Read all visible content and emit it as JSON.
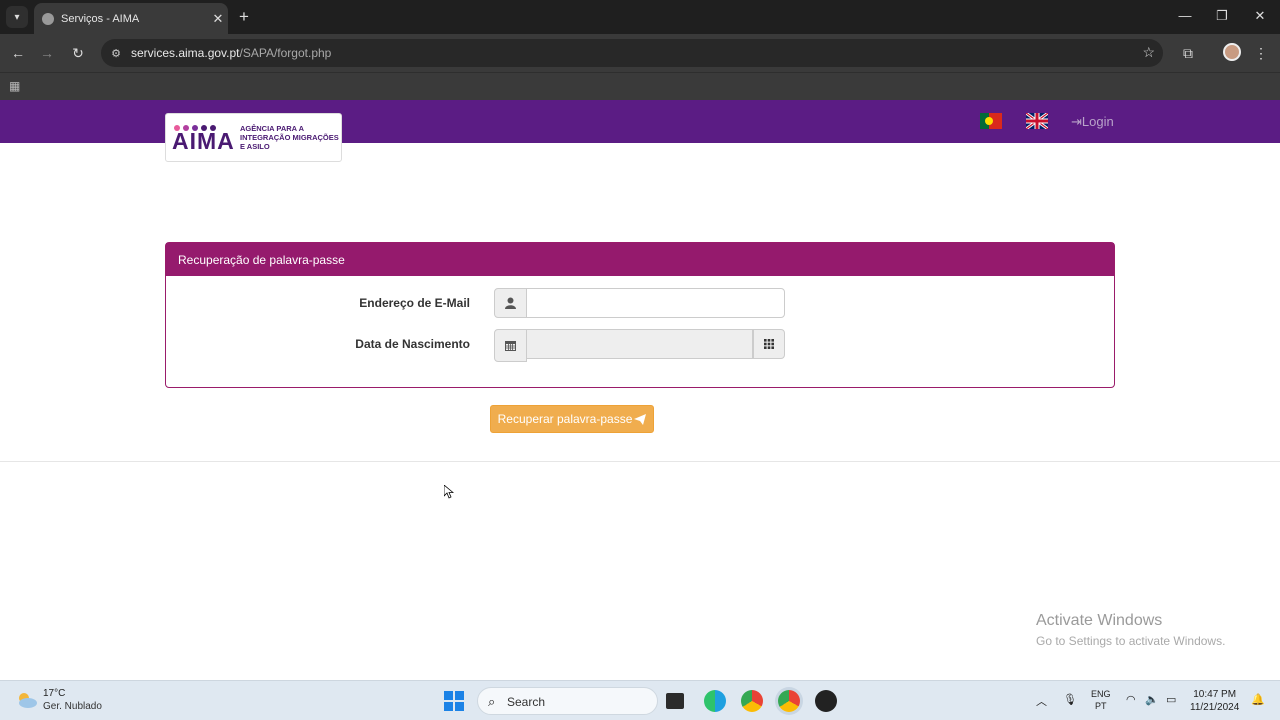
{
  "browser": {
    "tab_title": "Serviços - AIMA",
    "url_host": "services.aima.gov.pt",
    "url_path": "/SAPA/forgot.php"
  },
  "header": {
    "logo_text": "AIMA",
    "logo_subtitle": "AGÊNCIA PARA A INTEGRAÇÃO MIGRAÇÕES E ASILO",
    "login_label": "Login"
  },
  "form": {
    "title": "Recuperação de palavra-passe",
    "email_label": "Endereço de E-Mail",
    "email_value": "",
    "dob_label": "Data de Nascimento",
    "dob_value": "",
    "submit_label": "Recuperar palavra-passe"
  },
  "watermark": {
    "line1": "Activate Windows",
    "line2": "Go to Settings to activate Windows."
  },
  "taskbar": {
    "temperature": "17°C",
    "weather": "Ger. Nublado",
    "search_label": "Search",
    "lang_top": "ENG",
    "lang_bottom": "PT",
    "time": "10:47 PM",
    "date": "11/21/2024"
  },
  "colors": {
    "header": "#5b1c84",
    "panel_heading": "#951a6d",
    "submit": "#f0ad4e"
  }
}
